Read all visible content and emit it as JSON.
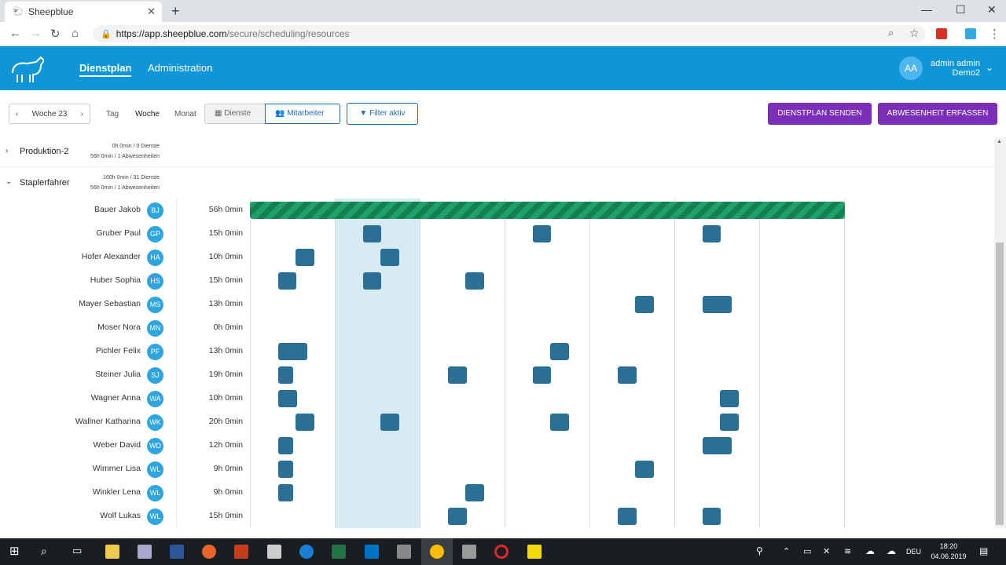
{
  "browser": {
    "tab_title": "Sheepblue",
    "url_main": "https://app.sheepblue.com",
    "url_path": "/secure/scheduling/resources"
  },
  "header": {
    "nav": [
      "Dienstplan",
      "Administration"
    ],
    "avatar_initials": "AA",
    "user_name": "admin admin",
    "user_org": "Demo2"
  },
  "toolbar": {
    "week_label": "Woche 23",
    "views": [
      "Tag",
      "Woche",
      "Monat"
    ],
    "dienste_label": "Dienste",
    "mitarbeiter_label": "Mitarbeiter",
    "filter_label": "Filter aktiv",
    "send_label": "DIENSTPLAN SENDEN",
    "absence_label": "ABWESENHEIT ERFASSEN"
  },
  "groups": [
    {
      "name": "Produktion-2",
      "stat1": "0h 0min / 0 Dienste",
      "stat2": "56h 0min / 1 Abwesenheiten"
    },
    {
      "name": "Staplerfahrer",
      "stat1": "160h 0min / 31 Dienste",
      "stat2": "56h 0min / 1 Abwesenheiten"
    }
  ],
  "employees": [
    {
      "name": "Bauer Jakob",
      "initials": "BJ",
      "hours": "56h 0min"
    },
    {
      "name": "Gruber Paul",
      "initials": "GP",
      "hours": "15h 0min"
    },
    {
      "name": "Hofer Alexander",
      "initials": "HA",
      "hours": "10h 0min"
    },
    {
      "name": "Huber Sophia",
      "initials": "HS",
      "hours": "15h 0min"
    },
    {
      "name": "Mayer Sebastian",
      "initials": "MS",
      "hours": "13h 0min"
    },
    {
      "name": "Moser Nora",
      "initials": "MN",
      "hours": "0h 0min"
    },
    {
      "name": "Pichler Felix",
      "initials": "PF",
      "hours": "13h 0min"
    },
    {
      "name": "Steiner Julia",
      "initials": "SJ",
      "hours": "19h 0min"
    },
    {
      "name": "Wagner Anna",
      "initials": "WA",
      "hours": "10h 0min"
    },
    {
      "name": "Wallner Katharina",
      "initials": "WK",
      "hours": "20h 0min"
    },
    {
      "name": "Weber David",
      "initials": "WD",
      "hours": "12h 0min"
    },
    {
      "name": "Wimmer Lisa",
      "initials": "WL",
      "hours": "9h 0min"
    },
    {
      "name": "Winkler Lena",
      "initials": "WL",
      "hours": "9h 0min"
    },
    {
      "name": "Wolf Lukas",
      "initials": "WL",
      "hours": "15h 0min"
    }
  ],
  "taskbar": {
    "language": "DEU",
    "time": "18:20",
    "date": "04.06.2019"
  }
}
